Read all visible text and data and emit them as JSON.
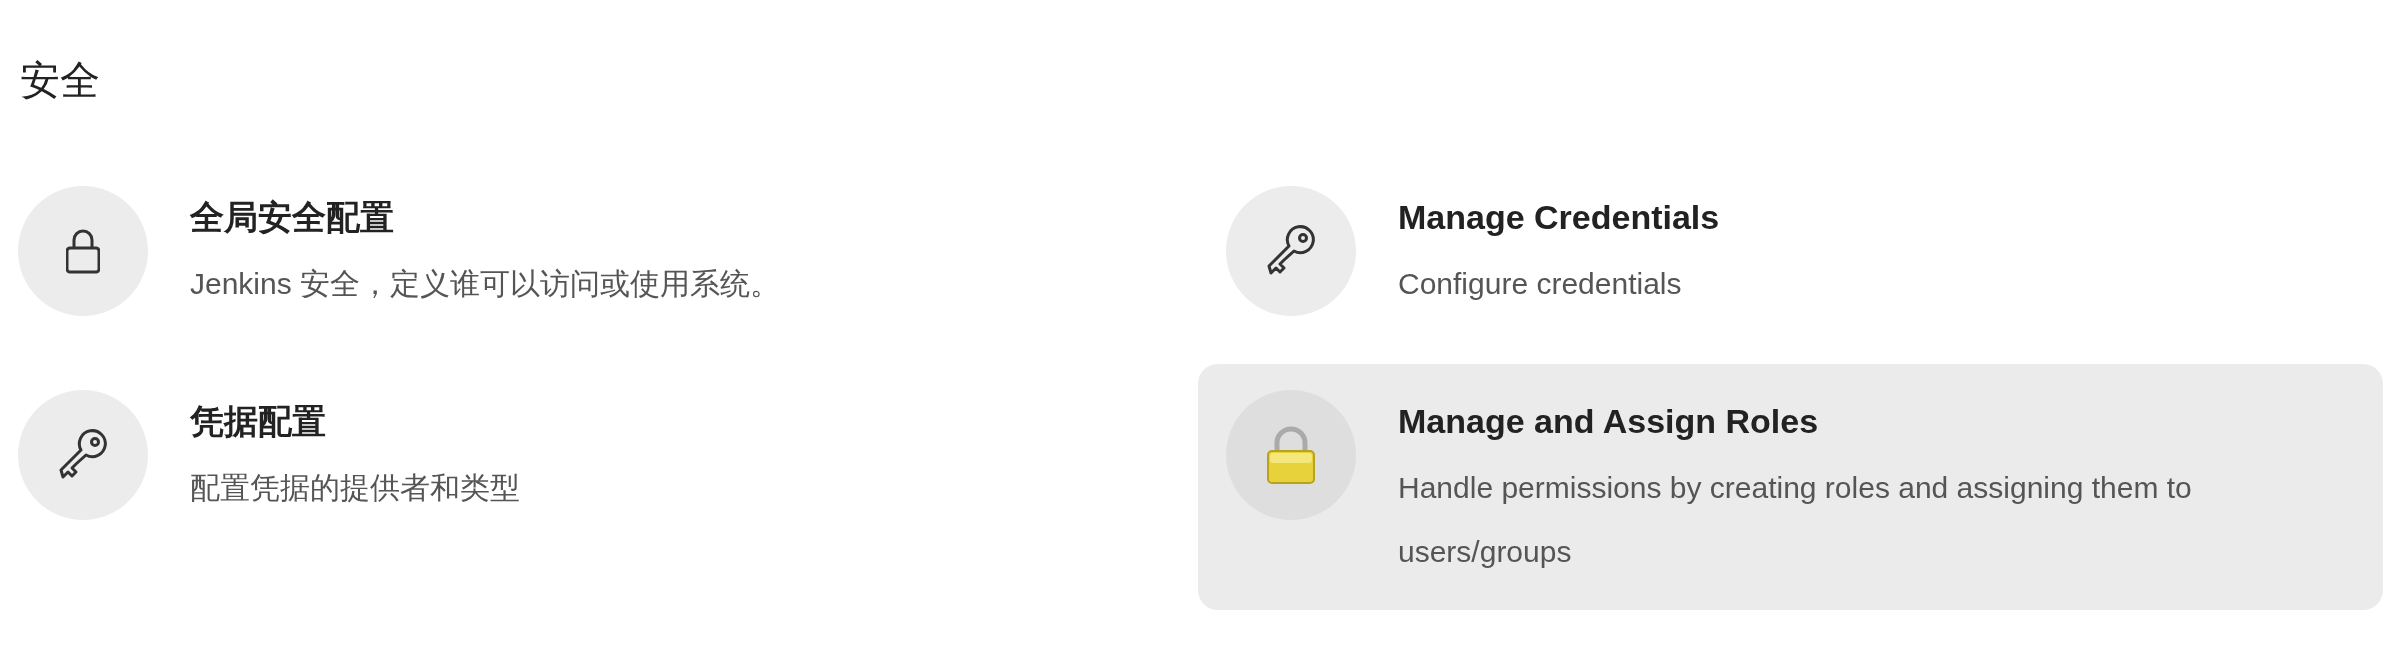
{
  "section": {
    "title": "安全"
  },
  "items": [
    {
      "title": "全局安全配置",
      "description": "Jenkins 安全，定义谁可以访问或使用系统。",
      "kind": "lock",
      "selected": false
    },
    {
      "title": "Manage Credentials",
      "description": "Configure credentials",
      "kind": "key",
      "selected": false
    },
    {
      "title": "凭据配置",
      "description": "配置凭据的提供者和类型",
      "kind": "key",
      "selected": false
    },
    {
      "title": "Manage and Assign Roles",
      "description": "Handle permissions by creating roles and assigning them to users/groups",
      "kind": "padlock",
      "selected": true
    }
  ]
}
